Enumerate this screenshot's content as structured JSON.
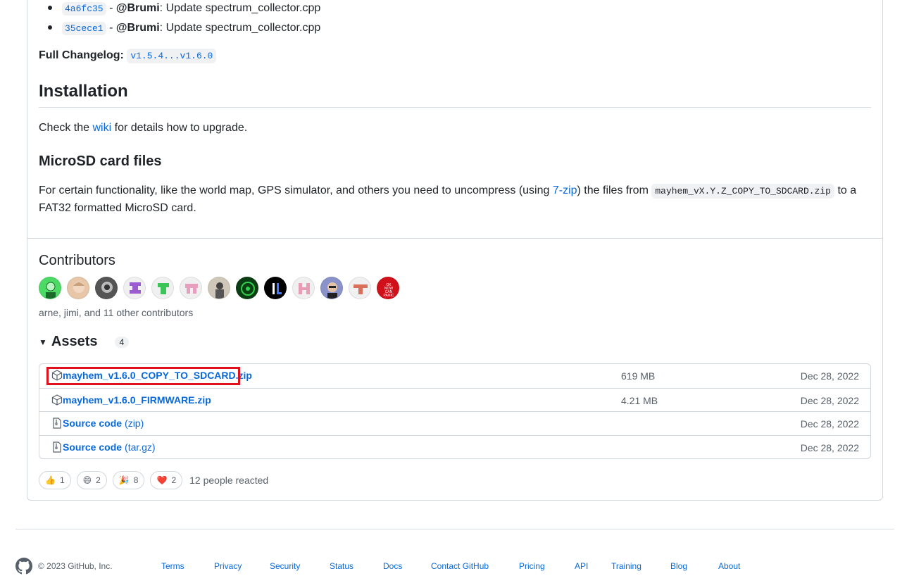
{
  "commits": [
    {
      "sha": "4a6fc35",
      "author": "@Brumi",
      "message": "Update spectrum_collector.cpp"
    },
    {
      "sha": "35cece1",
      "author": "@Brumi",
      "message": "Update spectrum_collector.cpp"
    }
  ],
  "changelog": {
    "label": "Full Changelog:",
    "range": "v1.5.4...v1.6.0"
  },
  "installation": {
    "heading": "Installation",
    "text_before": "Check the",
    "link": "wiki",
    "text_after": "for details how to upgrade."
  },
  "microsd": {
    "heading": "MicroSD card files",
    "text1": "For certain functionality, like the world map, GPS simulator, and others you need to uncompress (using",
    "link": "7-zip",
    "text2": ") the files from",
    "code": "mayhem_vX.Y.Z_COPY_TO_SDCARD.zip",
    "text3": "to a",
    "text4": "FAT32 formatted MicroSD card."
  },
  "contributors": {
    "heading": "Contributors",
    "summary": "arne, jimi, and 11 other contributors",
    "avatars": [
      "avatar-1",
      "avatar-2",
      "avatar-3",
      "avatar-4",
      "avatar-5",
      "avatar-6",
      "avatar-7",
      "avatar-8",
      "avatar-9",
      "avatar-10",
      "avatar-11",
      "avatar-12",
      "avatar-13"
    ]
  },
  "assets": {
    "heading": "Assets",
    "count": "4",
    "items": [
      {
        "name": "mayhem_v1.6.0_COPY_TO_SDCARD.zip",
        "suffix": "",
        "size": "619 MB",
        "date": "Dec 28, 2022",
        "icon": "package-icon"
      },
      {
        "name": "mayhem_v1.6.0_FIRMWARE.zip",
        "suffix": "",
        "size": "4.21 MB",
        "date": "Dec 28, 2022",
        "icon": "package-icon"
      },
      {
        "name": "Source code",
        "suffix": "(zip)",
        "size": "",
        "date": "Dec 28, 2022",
        "icon": "file-zip-icon"
      },
      {
        "name": "Source code",
        "suffix": "(tar.gz)",
        "size": "",
        "date": "Dec 28, 2022",
        "icon": "file-zip-icon"
      }
    ]
  },
  "reactions": {
    "items": [
      {
        "emoji": "👍",
        "count": "1"
      },
      {
        "emoji": "😄",
        "count": "2"
      },
      {
        "emoji": "🎉",
        "count": "8"
      },
      {
        "emoji": "❤️",
        "count": "2"
      }
    ],
    "summary": "12 people reacted"
  },
  "footer": {
    "copyright": "© 2023 GitHub, Inc.",
    "links": [
      "Terms",
      "Privacy",
      "Security",
      "Status",
      "Docs",
      "Contact GitHub",
      "Pricing",
      "API",
      "Training",
      "Blog",
      "About"
    ]
  },
  "colors": {
    "link": "#0969da",
    "highlight": "#e0101c",
    "border": "#d0d7de"
  }
}
